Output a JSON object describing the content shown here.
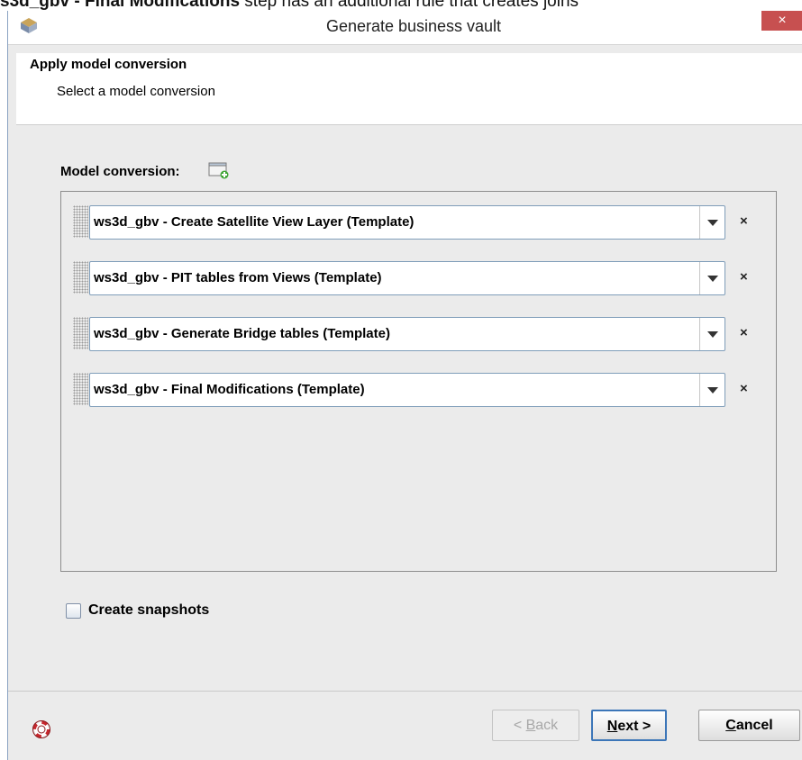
{
  "overlay": {
    "bold": "s3d_gbv - Final Modifications",
    "rest": " step has an additional rule that creates joins"
  },
  "window": {
    "title": "Generate business vault",
    "close_label": "×"
  },
  "header": {
    "title": "Apply model conversion",
    "subtitle": "Select a model conversion"
  },
  "model_conversion": {
    "label": "Model conversion:",
    "items": [
      {
        "label": "ws3d_gbv - Create Satellite View Layer (Template)"
      },
      {
        "label": "ws3d_gbv - PIT tables from Views (Template)"
      },
      {
        "label": "ws3d_gbv - Generate Bridge tables (Template)"
      },
      {
        "label": "ws3d_gbv - Final Modifications (Template)"
      }
    ],
    "remove_label": "×"
  },
  "snapshots": {
    "label": "Create snapshots",
    "checked": false
  },
  "buttons": {
    "back": {
      "mnemonic": "B",
      "prefix": "< ",
      "rest": "ack"
    },
    "next": {
      "mnemonic": "N",
      "rest": "ext >"
    },
    "cancel": {
      "mnemonic": "C",
      "rest": "ancel"
    }
  },
  "icons": {
    "app": "wherescape-app-icon",
    "add": "add-conversion-icon",
    "help": "lifebuoy-help-icon"
  }
}
